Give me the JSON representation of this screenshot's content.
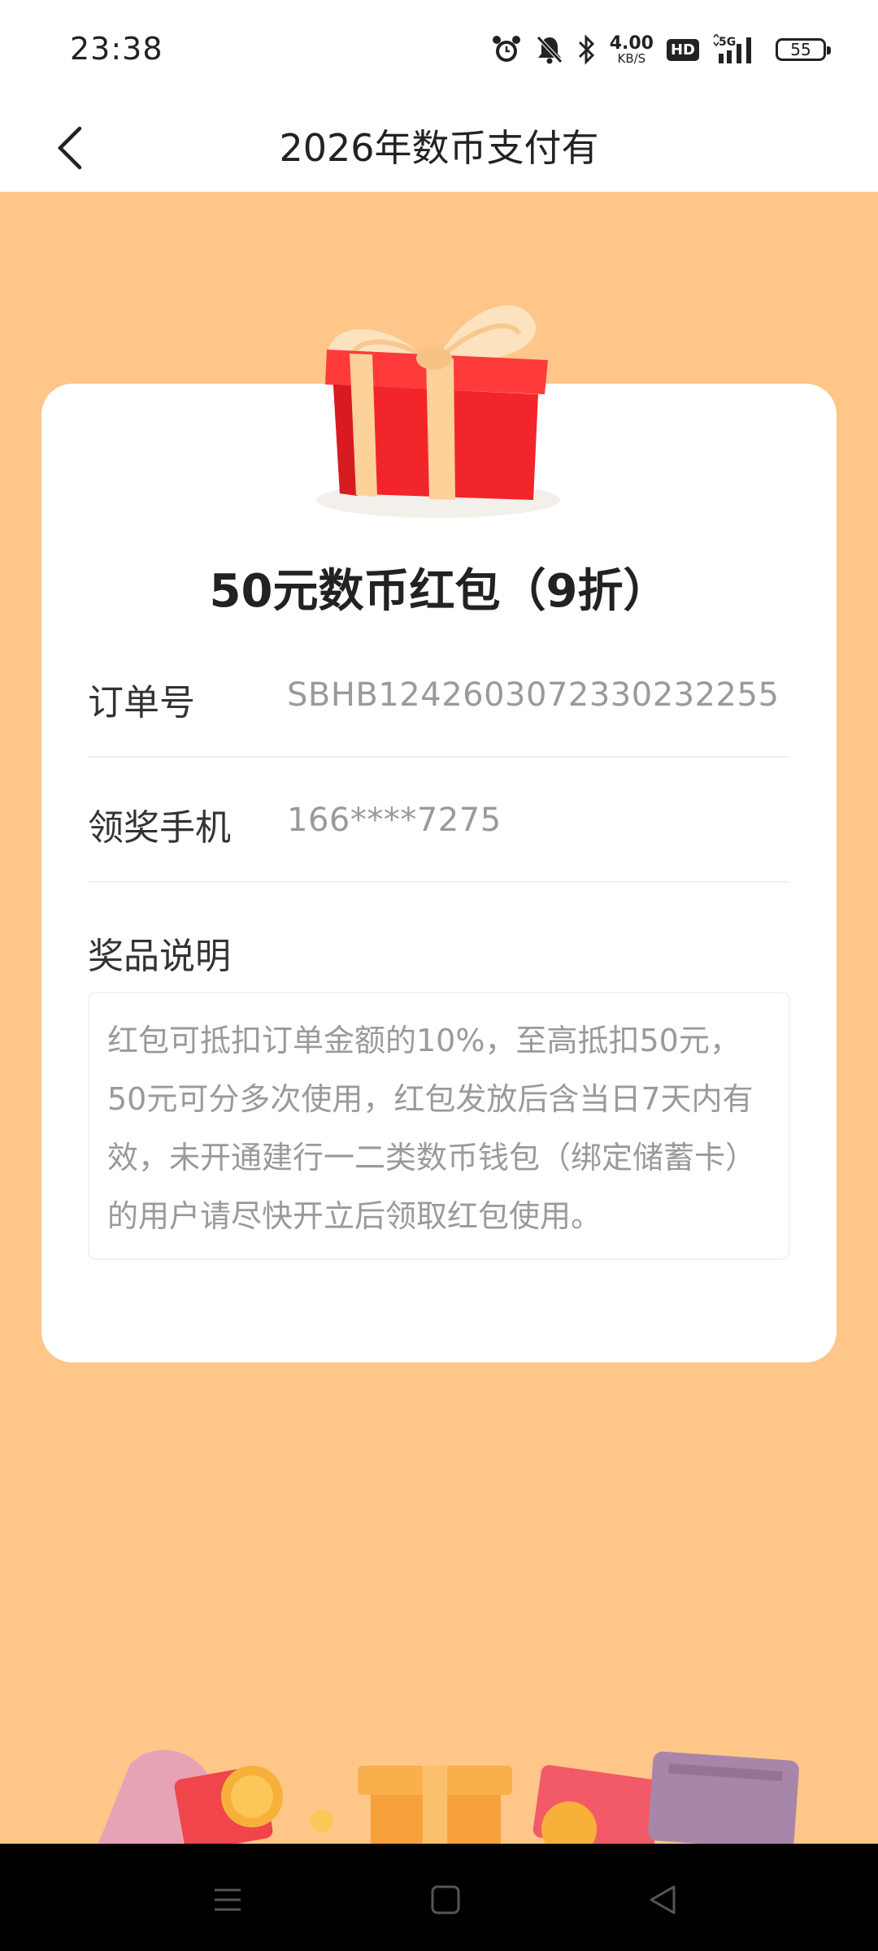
{
  "status_bar": {
    "time": "23:38",
    "net_speed_value": "4.00",
    "net_speed_unit": "KB/S",
    "hd_label": "HD",
    "network_label": "5G",
    "battery": "55",
    "icons": [
      "alarm-icon",
      "mute-icon",
      "bluetooth-icon",
      "hd-icon",
      "signal-icon",
      "battery-icon"
    ]
  },
  "header": {
    "title": "2026年数币支付有",
    "back_icon": "chevron-left-icon"
  },
  "prize": {
    "title": "50元数币红包（9折）",
    "order_label": "订单号",
    "order_value": "SBHB1242603072330232255",
    "phone_label": "领奖手机",
    "phone_value": "166****7275",
    "desc_label": "奖品说明",
    "desc_text": "红包可抵扣订单金额的10%，至高抵扣50元，50元可分多次使用，红包发放后含当日7天内有效，未开通建行一二类数币钱包（绑定储蓄卡）的用户请尽快开立后领取红包使用。"
  },
  "colors": {
    "background": "#fec689",
    "card": "#ffffff",
    "gift_red": "#f2252a",
    "ribbon": "#fcd19a"
  },
  "system_nav": [
    "menu-icon",
    "home-icon",
    "back-icon"
  ]
}
